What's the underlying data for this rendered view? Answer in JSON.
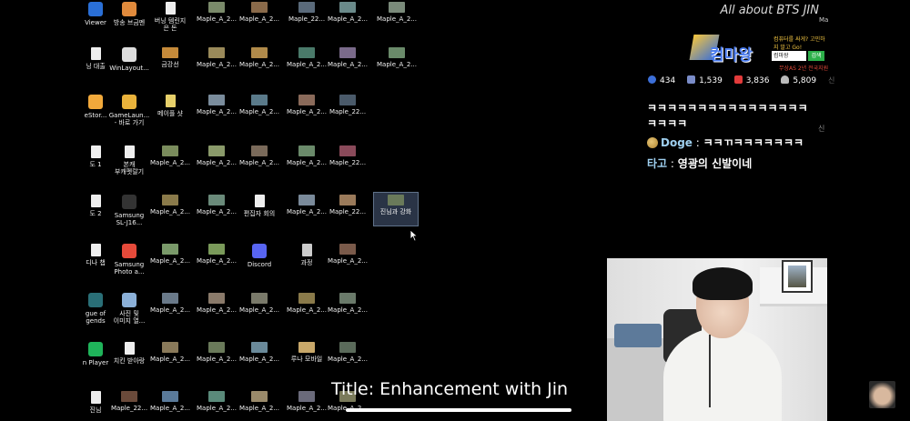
{
  "desktop": {
    "columns": [
      {
        "items": [
          {
            "label": "Viewer",
            "l2": "",
            "kind": "app",
            "color": "#2a6fd6"
          },
          {
            "label": "닝 대출",
            "l2": "",
            "kind": "file",
            "color": "#eee"
          },
          {
            "label": "eStor...",
            "l2": "",
            "kind": "app",
            "color": "#f2a93b"
          },
          {
            "label": "도 1",
            "l2": "",
            "kind": "file",
            "color": "#eee"
          },
          {
            "label": "도 2",
            "l2": "",
            "kind": "file",
            "color": "#eee"
          },
          {
            "label": "디나 챕",
            "l2": "",
            "kind": "file",
            "color": "#eee"
          },
          {
            "label": "gue of",
            "l2": "gends",
            "kind": "app",
            "color": "#2a6f77"
          },
          {
            "label": "n Player",
            "l2": "",
            "kind": "app",
            "color": "#1fb45a"
          },
          {
            "label": "진님",
            "l2": "",
            "kind": "file",
            "color": "#eee"
          }
        ]
      },
      {
        "items": [
          {
            "label": "방송 브금멘",
            "l2": "",
            "kind": "app",
            "color": "#e08a3c"
          },
          {
            "label": "WinLayout...",
            "l2": "",
            "kind": "app",
            "color": "#ddd"
          },
          {
            "label": "GameLaun...",
            "l2": "- 바로 가기",
            "kind": "app",
            "color": "#e9b23b"
          },
          {
            "label": "본캐",
            "l2": "부캐펫랄기",
            "kind": "file",
            "color": "#eee"
          },
          {
            "label": "Samsung",
            "l2": "SL-J16...",
            "kind": "app",
            "color": "#333"
          },
          {
            "label": "Samsung",
            "l2": "Photo a...",
            "kind": "app",
            "color": "#e64a3a"
          },
          {
            "label": "사진 및",
            "l2": "이미지 열...",
            "kind": "app",
            "color": "#8bb0d8"
          },
          {
            "label": "치킨 받아랑",
            "l2": "",
            "kind": "file",
            "color": "#eee"
          },
          {
            "label": "Maple_22...",
            "l2": "",
            "kind": "img",
            "color": "#6a4a3a"
          }
        ]
      },
      {
        "items": [
          {
            "label": "버닝 템린지",
            "l2": "은 돈",
            "kind": "file",
            "color": "#eee"
          },
          {
            "label": "금강선",
            "l2": "",
            "kind": "img",
            "color": "#c58a3a"
          },
          {
            "label": "메이플 샷",
            "l2": "",
            "kind": "file",
            "color": "#e7d06a"
          },
          {
            "label": "Maple_A_2...",
            "l2": "",
            "kind": "img",
            "color": "#7a8c5c"
          },
          {
            "label": "Maple_A_2...",
            "l2": "",
            "kind": "img",
            "color": "#8a7a4a"
          },
          {
            "label": "Maple_A_2...",
            "l2": "",
            "kind": "img",
            "color": "#7a9a6a"
          },
          {
            "label": "Maple_A_2...",
            "l2": "",
            "kind": "img",
            "color": "#6a7a8a"
          },
          {
            "label": "Maple_A_2...",
            "l2": "",
            "kind": "img",
            "color": "#8a7a5a"
          },
          {
            "label": "Maple_A_2...",
            "l2": "",
            "kind": "img",
            "color": "#5a7a9a"
          }
        ]
      },
      {
        "items": [
          {
            "label": "Maple_A_2...",
            "l2": "",
            "kind": "img",
            "color": "#7a8a6a"
          },
          {
            "label": "Maple_A_2...",
            "l2": "",
            "kind": "img",
            "color": "#9a8a5a"
          },
          {
            "label": "Maple_A_2...",
            "l2": "",
            "kind": "img",
            "color": "#7a8c9c"
          },
          {
            "label": "Maple_A_2...",
            "l2": "",
            "kind": "img",
            "color": "#8a9a6a"
          },
          {
            "label": "Maple_A_2...",
            "l2": "",
            "kind": "img",
            "color": "#6a8a7a"
          },
          {
            "label": "Maple_A_2...",
            "l2": "",
            "kind": "img",
            "color": "#7a9a5a"
          },
          {
            "label": "Maple_A_2...",
            "l2": "",
            "kind": "img",
            "color": "#8a7a6a"
          },
          {
            "label": "Maple_A_2...",
            "l2": "",
            "kind": "img",
            "color": "#6a7a5a"
          },
          {
            "label": "Maple_A_2...",
            "l2": "",
            "kind": "img",
            "color": "#5a8a7a"
          }
        ]
      },
      {
        "items": [
          {
            "label": "Maple_A_2...",
            "l2": "",
            "kind": "img",
            "color": "#8a6a4a"
          },
          {
            "label": "Maple_A_2...",
            "l2": "",
            "kind": "img",
            "color": "#b08a4a"
          },
          {
            "label": "Maple_A_2...",
            "l2": "",
            "kind": "img",
            "color": "#5a7a8a"
          },
          {
            "label": "Maple_A_2...",
            "l2": "",
            "kind": "img",
            "color": "#7a6a5a"
          },
          {
            "label": "편집자 회의",
            "l2": "",
            "kind": "file",
            "color": "#eee"
          },
          {
            "label": "Discord",
            "l2": "",
            "kind": "app",
            "color": "#5865f2"
          },
          {
            "label": "Maple_A_2...",
            "l2": "",
            "kind": "img",
            "color": "#7a7a6a"
          },
          {
            "label": "Maple_A_2...",
            "l2": "",
            "kind": "img",
            "color": "#6a8a9a"
          },
          {
            "label": "Maple_A_2...",
            "l2": "",
            "kind": "img",
            "color": "#9a8a6a"
          }
        ]
      },
      {
        "items": [
          {
            "label": "Maple_22...",
            "l2": "",
            "kind": "img",
            "color": "#5a6a7a"
          },
          {
            "label": "Maple_A_2...",
            "l2": "",
            "kind": "img",
            "color": "#4a7a6a"
          },
          {
            "label": "Maple_A_2...",
            "l2": "",
            "kind": "img",
            "color": "#8a6a5a"
          },
          {
            "label": "Maple_A_2...",
            "l2": "",
            "kind": "img",
            "color": "#6a8a6a"
          },
          {
            "label": "Maple_A_2...",
            "l2": "",
            "kind": "img",
            "color": "#7a8a9a"
          },
          {
            "label": "과정",
            "l2": "",
            "kind": "file",
            "color": "#ccc"
          },
          {
            "label": "Maple_A_2...",
            "l2": "",
            "kind": "img",
            "color": "#8a7a4a"
          },
          {
            "label": "루나 모바일",
            "l2": "",
            "kind": "img",
            "color": "#c8a86a"
          },
          {
            "label": "Maple_A_2...",
            "l2": "",
            "kind": "img",
            "color": "#6a6a7a"
          }
        ]
      },
      {
        "items": [
          {
            "label": "Maple_A_2...",
            "l2": "",
            "kind": "img",
            "color": "#6a8a8a"
          },
          {
            "label": "Maple_A_2...",
            "l2": "",
            "kind": "img",
            "color": "#7a6a8a"
          },
          {
            "label": "Maple_22...",
            "l2": "",
            "kind": "img",
            "color": "#4a5a6a"
          },
          {
            "label": "Maple_22...",
            "l2": "",
            "kind": "img",
            "color": "#8a4a5a"
          },
          {
            "label": "Maple_22...",
            "l2": "",
            "kind": "img",
            "color": "#9a7a5a"
          },
          {
            "label": "Maple_A_2...",
            "l2": "",
            "kind": "img",
            "color": "#7a5a4a"
          },
          {
            "label": "Maple_A_2...",
            "l2": "",
            "kind": "img",
            "color": "#6a7a6a"
          },
          {
            "label": "Maple_A_2...",
            "l2": "",
            "kind": "img",
            "color": "#5a6a5a"
          },
          {
            "label": "Maple_A_2...",
            "l2": "",
            "kind": "img",
            "color": "#7a7a5a"
          }
        ]
      },
      {
        "items": [
          {
            "label": "Maple_A_2...",
            "l2": "",
            "kind": "img",
            "color": "#7a8a7a"
          },
          {
            "label": "Maple_A_2...",
            "l2": "",
            "kind": "img",
            "color": "#6a8a6a"
          },
          {
            "label": "",
            "l2": "",
            "kind": "none",
            "color": "#000"
          },
          {
            "label": "",
            "l2": "",
            "kind": "none",
            "color": "#000"
          },
          {
            "label": "진님과 강화",
            "l2": "",
            "kind": "img",
            "color": "#6a7a5a",
            "selected": true
          }
        ]
      }
    ]
  },
  "overlay": {
    "stream_title": "All about BTS JIN",
    "edge_tag": "Ma",
    "ad": {
      "brand": "컴마왕",
      "slogan": "컴퓨터를 싸게? 고민하지 말고 Go!",
      "search_value": "컴마왕",
      "search_btn": "검색",
      "footer": "무상AS 2년 전국지원"
    },
    "stats": [
      {
        "icon": "viewers-icon",
        "value": "434",
        "color": "#3c6fd8"
      },
      {
        "icon": "chat-icon",
        "value": "1,539",
        "color": "#7a8cc8"
      },
      {
        "icon": "youtube-icon",
        "value": "3,836",
        "color": "#e23b3b"
      },
      {
        "icon": "person-icon",
        "value": "5,809",
        "color": "#bbbbbb"
      }
    ],
    "stats_trunc": "신",
    "chat": {
      "spam_line1": "ㅋㅋㅋㅋㅋㅋㅋㅋㅋㅋㅋㅋㅋㅋㅋㅋ",
      "spam_line2": "ㅋㅋㅋㅋ",
      "edge_right": "신",
      "doge_name": "Doge",
      "doge_msg": "ㅋㅋㄲㅋㅋㅋㅋㅋㅋㅋ",
      "tago_name": "타고",
      "tago_msg": "영광의 신발이네",
      "sep": ":"
    },
    "subtitle": "Title: Enhancement with Jin"
  },
  "player": {
    "progress": 1.0
  }
}
